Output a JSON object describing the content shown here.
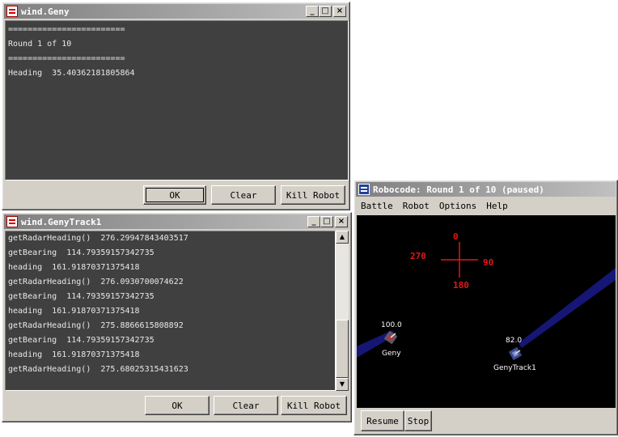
{
  "geny_window": {
    "title": "wind.Geny",
    "lines": [
      "========================",
      "Round 1 of 10",
      "========================",
      "Heading  35.40362181805864"
    ],
    "buttons": {
      "ok": "OK",
      "clear": "Clear",
      "kill": "Kill Robot"
    }
  },
  "track_window": {
    "title": "wind.GenyTrack1",
    "lines": [
      "getRadarHeading()  276.29947843403517",
      "getBearing  114.79359157342735",
      "heading  161.91870371375418",
      "getRadarHeading()  276.0930700074622",
      "getBearing  114.79359157342735",
      "heading  161.91870371375418",
      "getRadarHeading()  275.8866615808892",
      "getBearing  114.79359157342735",
      "heading  161.91870371375418",
      "getRadarHeading()  275.68025315431623"
    ],
    "buttons": {
      "ok": "OK",
      "clear": "Clear",
      "kill": "Kill Robot"
    }
  },
  "robocode_window": {
    "title": "Robocode: Round 1 of 10 (paused)",
    "menu": [
      "Battle",
      "Robot",
      "Options",
      "Help"
    ],
    "compass": {
      "north": "0",
      "east": "90",
      "south": "180",
      "west": "270"
    },
    "robots": [
      {
        "name": "Geny",
        "energy": "100.0"
      },
      {
        "name": "GenyTrack1",
        "energy": "82.0"
      }
    ],
    "buttons": {
      "resume": "Resume",
      "stop": "Stop"
    }
  },
  "colors": {
    "title_active": "#0a246a",
    "console_bg": "#404040",
    "compass": "#e01818",
    "radar_beam": "#1a1a8c"
  }
}
